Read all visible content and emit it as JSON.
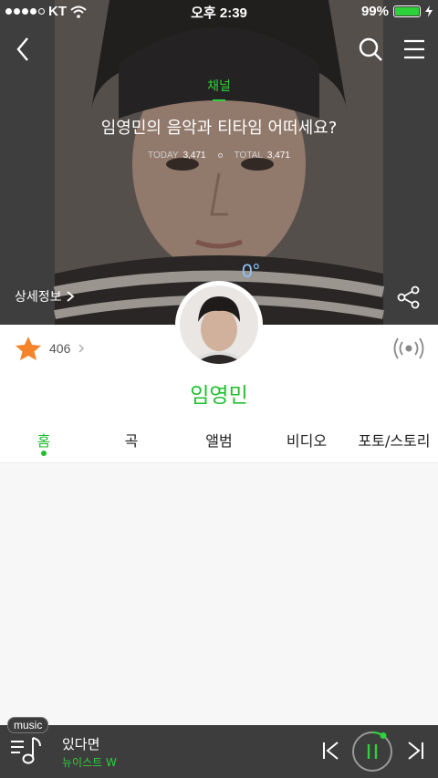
{
  "status_bar": {
    "carrier": "KT",
    "time": "오후 2:39",
    "battery": "99%"
  },
  "hero": {
    "channel_label": "채널",
    "title": "임영민의 음악과 티타임 어떠세요?",
    "today_label": "TODAY",
    "today_value": "3,471",
    "total_label": "TOTAL",
    "total_value": "3,471",
    "temperature": "0°",
    "detail_link": "상세정보"
  },
  "profile": {
    "favorite_count": "406",
    "artist_name": "임영민"
  },
  "tabs": [
    {
      "label": "홈"
    },
    {
      "label": "곡"
    },
    {
      "label": "앨범"
    },
    {
      "label": "비디오"
    },
    {
      "label": "포토/스토리"
    }
  ],
  "player": {
    "badge": "music",
    "track_title": "있다면",
    "track_artist": "뉴이스트 W"
  },
  "colors": {
    "accent": "#1fbf2e",
    "player_bg": "#3d3d3d",
    "star": "#f5832a"
  }
}
